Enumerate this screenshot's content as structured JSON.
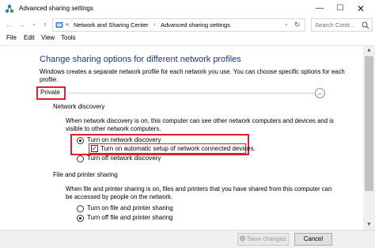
{
  "window": {
    "title": "Advanced sharing settings",
    "minimize_glyph": "—",
    "maximize_glyph": "☐",
    "close_glyph": "✕"
  },
  "navigation": {
    "back_glyph": "←",
    "forward_glyph": "→",
    "recent_glyph": "⌄",
    "up_glyph": "↑",
    "prefix": "«",
    "breadcrumbs": [
      "Network and Sharing Center",
      "Advanced sharing settings"
    ],
    "separator": "›",
    "dropdown_glyph": "⌄",
    "refresh_glyph": "↻",
    "search_placeholder": "Search Contr..."
  },
  "menu": [
    "File",
    "Edit",
    "View",
    "Tools"
  ],
  "main": {
    "heading": "Change sharing options for different network profiles",
    "description": "Windows creates a separate network profile for each network you use. You can choose specific options for each profile.",
    "profile_name": "Private",
    "collapse_glyph": "︿",
    "network_discovery": {
      "title": "Network discovery",
      "description": "When network discovery is on, this computer can see other network computers and devices and is visible to other network computers.",
      "options": [
        {
          "label": "Turn on network discovery",
          "selected": true
        },
        {
          "label": "Turn off network discovery",
          "selected": false
        }
      ],
      "auto_setup": {
        "label": "Turn on automatic setup of network connected devices.",
        "checked": true
      }
    },
    "file_printer_sharing": {
      "title": "File and printer sharing",
      "description": "When file and printer sharing is on, files and printers that you have shared from this computer can be accessed by people on the network.",
      "options": [
        {
          "label": "Turn on file and printer sharing",
          "selected": true
        },
        {
          "label": "Turn off file and printer sharing",
          "selected": false
        }
      ]
    }
  },
  "scrollbar": {
    "up_glyph": "▲",
    "down_glyph": "▼"
  },
  "footer": {
    "save_label": "Save changes",
    "cancel_label": "Cancel"
  },
  "colors": {
    "heading": "#1e3287",
    "highlight": "#e0202a"
  }
}
